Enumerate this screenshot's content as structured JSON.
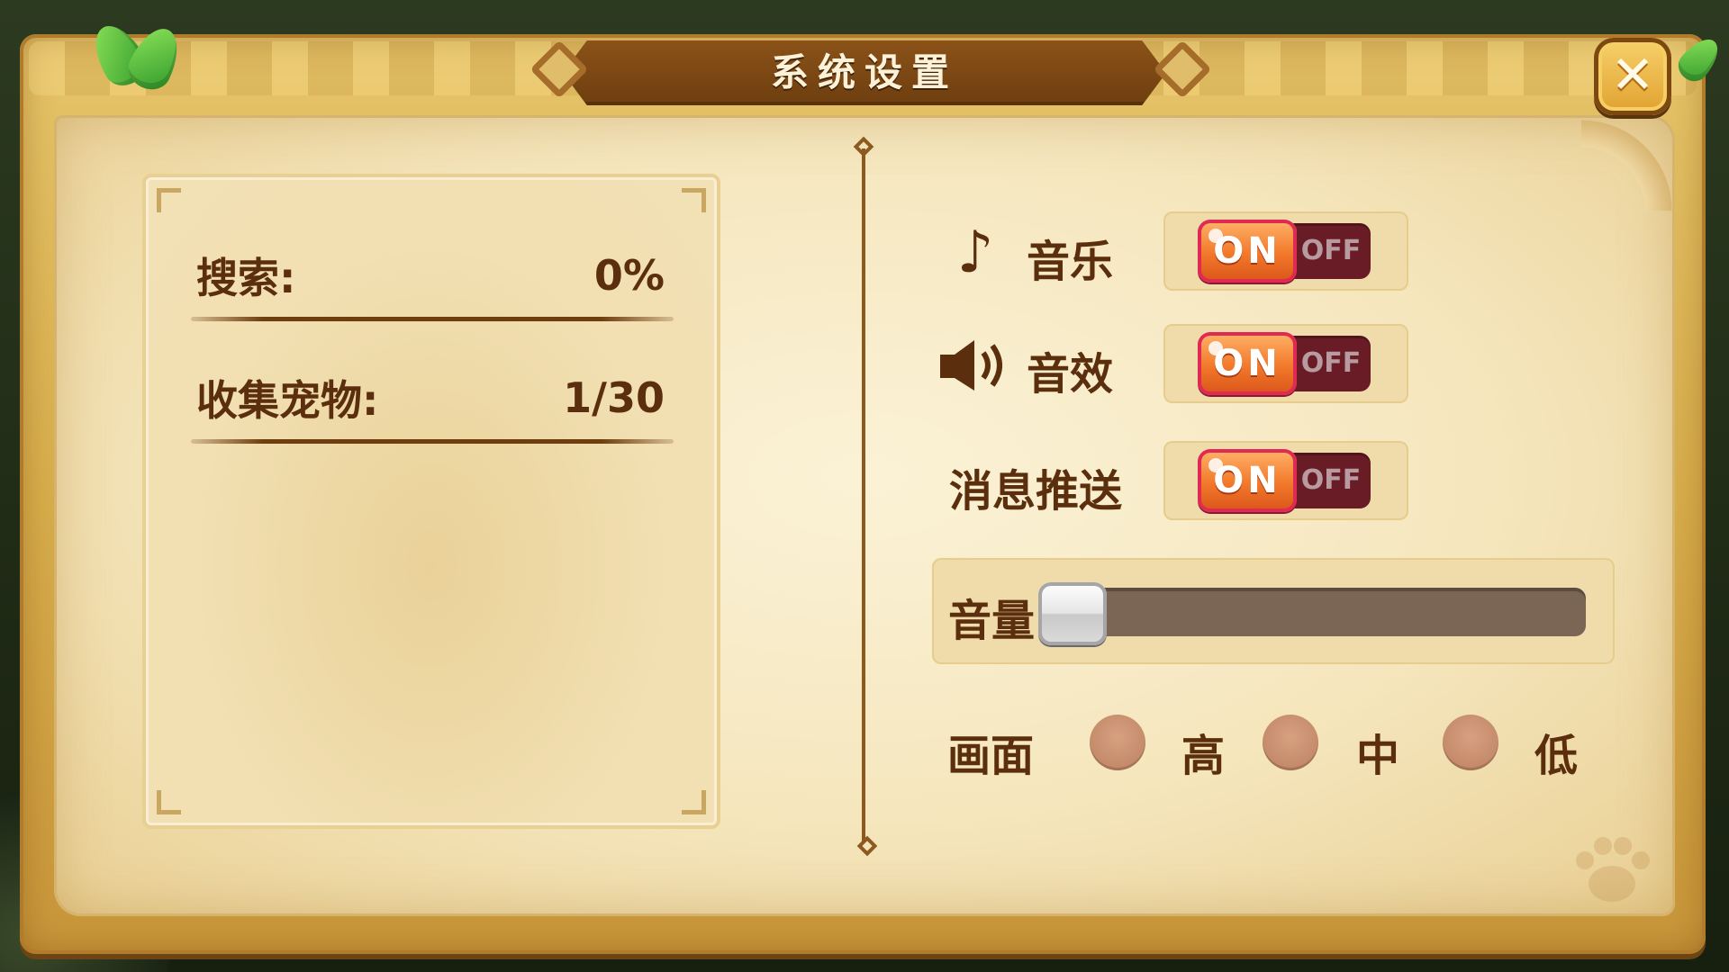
{
  "dialog": {
    "title": "系统设置",
    "close_icon": "close-x-icon"
  },
  "stats": {
    "items": [
      {
        "label": "搜索:",
        "value": "0%"
      },
      {
        "label": "收集宠物:",
        "value": "1/30"
      }
    ]
  },
  "settings": {
    "music": {
      "icon": "music-note-icon",
      "label": "音乐",
      "on_label": "ON",
      "off_label": "OFF",
      "state": "on"
    },
    "sound": {
      "icon": "speaker-icon",
      "label": "音效",
      "on_label": "ON",
      "off_label": "OFF",
      "state": "on"
    },
    "push": {
      "label": "消息推送",
      "on_label": "ON",
      "off_label": "OFF",
      "state": "on"
    },
    "volume": {
      "label": "音量",
      "level": 0
    },
    "graphics": {
      "label": "画面",
      "options": [
        "高",
        "中",
        "低"
      ]
    }
  },
  "colors": {
    "title_banner": "#6e3e0f",
    "toggle_on": "#f2782a",
    "toggle_off": "#6a1c26",
    "text": "#5b2f0e"
  }
}
